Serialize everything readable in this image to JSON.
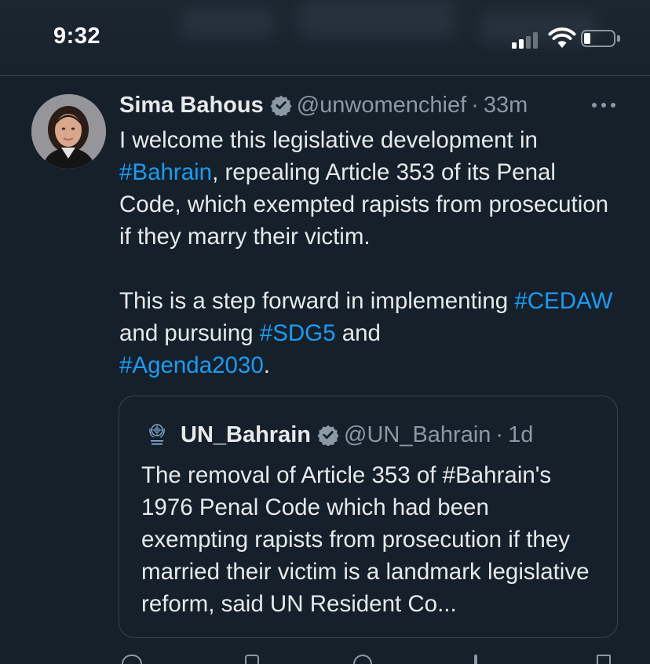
{
  "status_bar": {
    "time": "9:32"
  },
  "tweet": {
    "author": {
      "display_name": "Sima Bahous",
      "handle": "@unwomenchief",
      "time_ago": "33m",
      "separator": "·"
    },
    "text": {
      "p1_a": "I welcome this legislative development in ",
      "p1_hashtag": "#Bahrain",
      "p1_b": ", repealing Article 353 of its Penal Code, which exempted rapists from prosecution if they marry their victim.",
      "p2_a": "This is a step forward in implementing ",
      "p2_hashtag1": "#CEDAW",
      "p2_b": " and pursuing ",
      "p2_hashtag2": "#SDG5",
      "p2_c": " and ",
      "p2_hashtag3": "#Agenda2030",
      "p2_d": "."
    },
    "quote": {
      "display_name": "UN_Bahrain",
      "handle": "@UN_Bahrain",
      "time_ago": "1d",
      "separator": "·",
      "text": "The removal of Article 353 of #Bahrain's 1976 Penal Code which had been exempting rapists from prosecution if they married their victim is a landmark legislative reform, said UN Resident Co..."
    }
  },
  "icons": {
    "verified": "verified-badge-icon",
    "more": "more-options-icon",
    "signal": "cellular-signal-icon",
    "wifi": "wifi-icon",
    "battery": "battery-icon",
    "un_logo": "un-emblem-icon"
  },
  "colors": {
    "background": "#15202b",
    "text": "#e7e9ea",
    "secondary_text": "#8b98a5",
    "link": "#1d9bf0",
    "border": "#38444d"
  }
}
